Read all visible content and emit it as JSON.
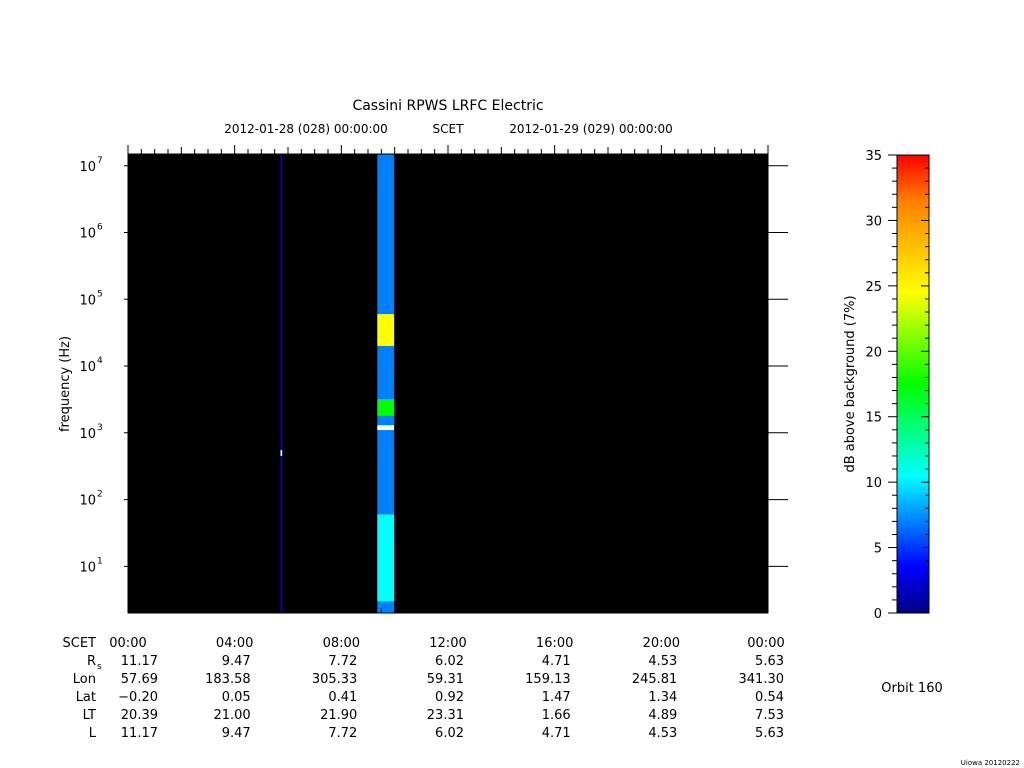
{
  "chart_data": {
    "type": "heatmap",
    "title": "Cassini RPWS LRFC Electric",
    "time_range": {
      "start": "2012-01-28 (028) 00:00:00",
      "scet_label": "SCET",
      "end": "2012-01-29 (029) 00:00:00"
    },
    "ylabel": "frequency (Hz)",
    "y_scale": "log",
    "ylim_hz": [
      2,
      15000000
    ],
    "y_ticks": [
      {
        "value": 10,
        "base": "10",
        "exp": "1"
      },
      {
        "value": 100,
        "base": "10",
        "exp": "2"
      },
      {
        "value": 1000,
        "base": "10",
        "exp": "3"
      },
      {
        "value": 10000,
        "base": "10",
        "exp": "4"
      },
      {
        "value": 100000,
        "base": "10",
        "exp": "5"
      },
      {
        "value": 1000000,
        "base": "10",
        "exp": "6"
      },
      {
        "value": 10000000,
        "base": "10",
        "exp": "7"
      }
    ],
    "x_hours_range": [
      0,
      24
    ],
    "x_ticks": [
      {
        "hour": 0,
        "label": "00:00"
      },
      {
        "hour": 4,
        "label": "04:00"
      },
      {
        "hour": 8,
        "label": "08:00"
      },
      {
        "hour": 12,
        "label": "12:00"
      },
      {
        "hour": 16,
        "label": "16:00"
      },
      {
        "hour": 20,
        "label": "20:00"
      },
      {
        "hour": 24,
        "label": "00:00"
      }
    ],
    "background_color": "#000000",
    "colorbar": {
      "label": "dB above background (7%)",
      "range": [
        0,
        35
      ],
      "ticks": [
        "0",
        "5",
        "10",
        "15",
        "20",
        "25",
        "30",
        "35"
      ],
      "colors": [
        "#000080",
        "#0000ff",
        "#0080ff",
        "#00ffff",
        "#00ff80",
        "#00ff00",
        "#80ff00",
        "#ffff00",
        "#ffc000",
        "#ff8000",
        "#ff0000"
      ]
    },
    "data_segments": [
      {
        "hour_start": 5.72,
        "hour_end": 5.78,
        "freq_min_hz": 2,
        "freq_max_hz": 15000000,
        "level_db": 2
      },
      {
        "hour_start": 9.35,
        "hour_end": 9.98,
        "freq_min_hz": 2,
        "freq_max_hz": 15000000,
        "level_db": 6
      }
    ],
    "features": [
      {
        "hour_start": 9.35,
        "hour_end": 9.98,
        "freq_min_hz": 20000,
        "freq_max_hz": 60000,
        "level_db": 25
      },
      {
        "hour_start": 9.35,
        "hour_end": 9.98,
        "freq_min_hz": 1800,
        "freq_max_hz": 3200,
        "level_db": 16
      },
      {
        "hour_start": 9.35,
        "hour_end": 9.98,
        "freq_min_hz": 3,
        "freq_max_hz": 60,
        "level_db": 12
      },
      {
        "hour_start": 9.35,
        "hour_end": 9.98,
        "freq_min_hz": 1100,
        "freq_max_hz": 1300,
        "level_db": 35
      },
      {
        "hour_start": 5.72,
        "hour_end": 5.78,
        "freq_min_hz": 450,
        "freq_max_hz": 550,
        "level_db": 35
      }
    ]
  },
  "ephemeris": {
    "rows": [
      {
        "label": "SCET",
        "sub": "",
        "values": [
          "00:00",
          "04:00",
          "08:00",
          "12:00",
          "16:00",
          "20:00",
          "00:00"
        ]
      },
      {
        "label": "R",
        "sub": "s",
        "values": [
          "11.17",
          "9.47",
          "7.72",
          "6.02",
          "4.71",
          "4.53",
          "5.63"
        ]
      },
      {
        "label": "Lon",
        "sub": "",
        "values": [
          "57.69",
          "183.58",
          "305.33",
          "59.31",
          "159.13",
          "245.81",
          "341.30"
        ]
      },
      {
        "label": "Lat",
        "sub": "",
        "values": [
          "−0.20",
          "0.05",
          "0.41",
          "0.92",
          "1.47",
          "1.34",
          "0.54"
        ]
      },
      {
        "label": "LT",
        "sub": "",
        "values": [
          "20.39",
          "21.00",
          "21.90",
          "23.31",
          "1.66",
          "4.89",
          "7.53"
        ]
      },
      {
        "label": "L",
        "sub": "",
        "values": [
          "11.17",
          "9.47",
          "7.72",
          "6.02",
          "4.71",
          "4.53",
          "5.63"
        ]
      }
    ]
  },
  "orbit_label": "Orbit 160",
  "footer_stamp": "Uiowa 20120222"
}
